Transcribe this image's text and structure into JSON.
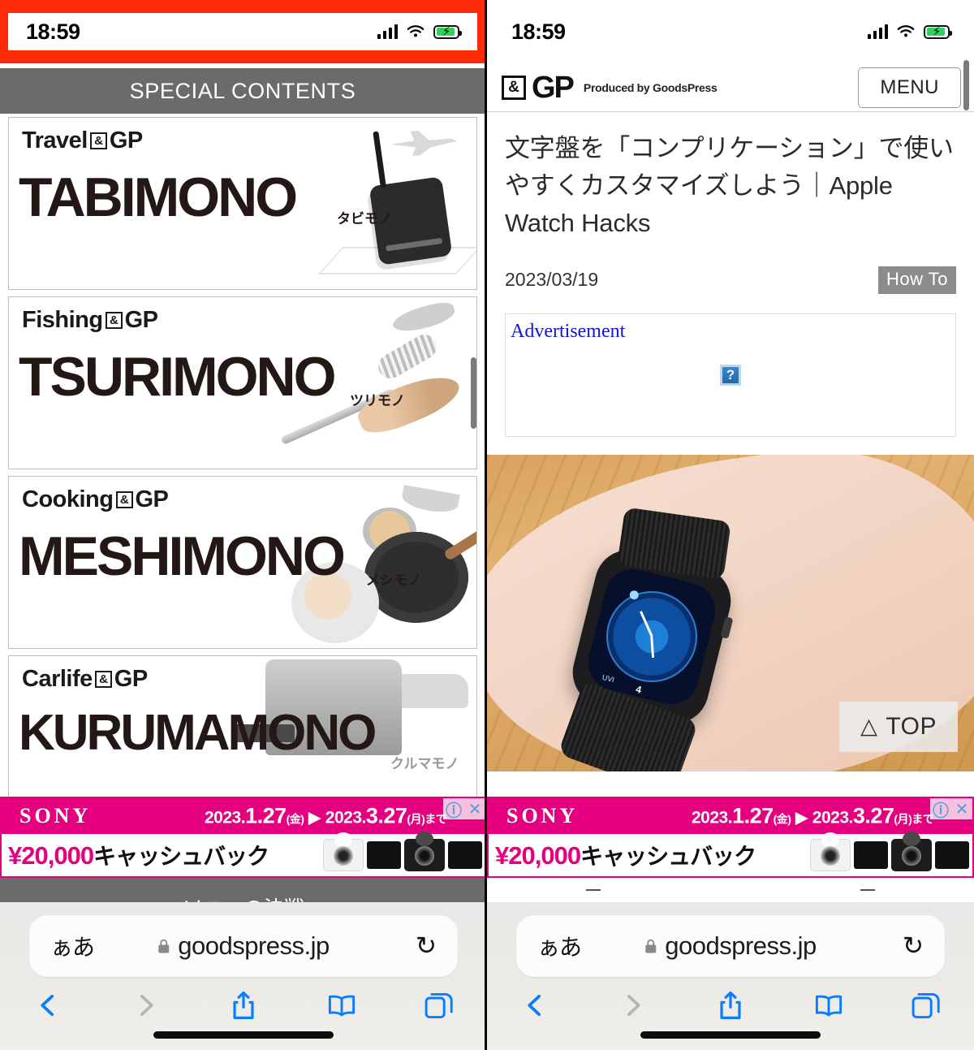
{
  "status_bar": {
    "time": "18:59",
    "icons": [
      "cellular-signal-icon",
      "wifi-icon",
      "battery-charging-icon"
    ]
  },
  "left_panel": {
    "section_header": "SPECIAL CONTENTS",
    "cards": [
      {
        "brand_prefix": "Travel",
        "brand_amp": "&",
        "brand_suffix": "GP",
        "word": "TABIMONO",
        "kana": "タビモノ"
      },
      {
        "brand_prefix": "Fishing",
        "brand_amp": "&",
        "brand_suffix": "GP",
        "word": "TSURIMONO",
        "kana": "ツリモノ"
      },
      {
        "brand_prefix": "Cooking",
        "brand_amp": "&",
        "brand_suffix": "GP",
        "word": "MESHIMONO",
        "kana": "メシモノ"
      },
      {
        "brand_prefix": "Carlife",
        "brand_amp": "&",
        "brand_suffix": "GP",
        "word": "KURUMAMONO",
        "kana": "クルマモノ"
      }
    ],
    "top_button": {
      "triangle": "△",
      "label": "TOP"
    },
    "cut_off_text": "ソニーの決戦"
  },
  "right_panel": {
    "site_logo": {
      "amp": "&",
      "gp": "GP",
      "tagline": "Produced by GoodsPress"
    },
    "menu_button": "MENU",
    "article": {
      "title": "文字盤を「コンプリケーション」で使いやすくカスタマイズしよう｜Apple Watch Hacks",
      "date": "2023/03/19",
      "category_badge": "How To"
    },
    "advertisement": {
      "label": "Advertisement",
      "broken_image_glyph": "?"
    },
    "hero_image_alt": "apple-watch-on-wrist-photo",
    "top_button": {
      "triangle": "△",
      "label": "TOP"
    }
  },
  "sony_ad": {
    "brand": "SONY",
    "date_range": {
      "start_year": "2023.",
      "start_date": "1.27",
      "start_day": "(金)",
      "arrow": "▶",
      "end_year": "2023.",
      "end_date": "3.27",
      "end_day": "(月)まで"
    },
    "offer_amount": "¥20,000",
    "offer_text": "キャッシュバック",
    "controls": {
      "info": "ⓘ",
      "close": "✕"
    },
    "product_images": [
      "white-camera",
      "black-screen-panel",
      "black-camera",
      "black-screen-panel"
    ]
  },
  "safari_toolbar": {
    "text_size_button": "ぁあ",
    "lock_icon": "lock-icon",
    "url": "goodspress.jp",
    "reload_icon": "reload-icon",
    "nav_icons": [
      "back-icon",
      "forward-icon",
      "share-icon",
      "bookmarks-icon",
      "tabs-icon"
    ]
  },
  "colors": {
    "status_bar_red": "#fc2a06",
    "special_bar_grey": "#6b6b6b",
    "sony_magenta": "#e5007f",
    "safari_blue": "#0a7cff",
    "ad_label_blue": "#1515cf",
    "badge_grey": "#8c8c8c"
  }
}
